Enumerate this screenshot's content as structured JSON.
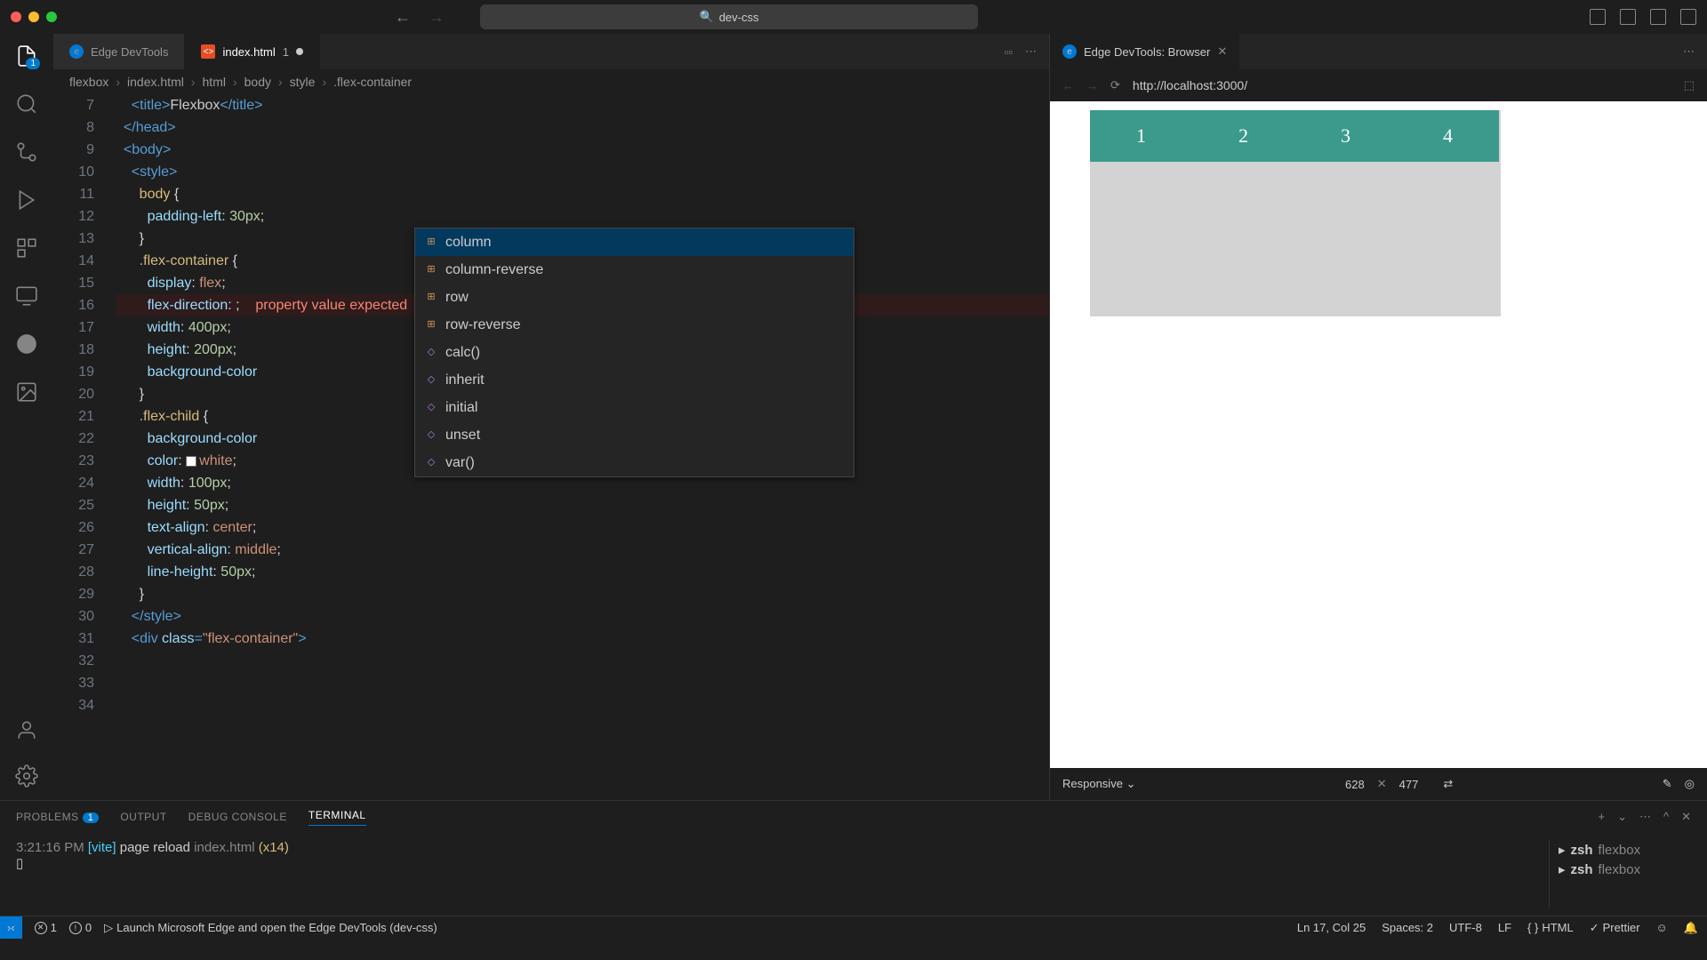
{
  "titlebar": {
    "project": "dev-css"
  },
  "tabs": [
    {
      "label": "Edge DevTools",
      "type": "edge"
    },
    {
      "label": "index.html",
      "type": "html",
      "count": "1",
      "dirty": true
    }
  ],
  "breadcrumb": [
    "flexbox",
    "index.html",
    "html",
    "body",
    "style",
    ".flex-container"
  ],
  "code": {
    "lines": [
      {
        "n": 7,
        "html": "    <span class='tag'>&lt;<span class='tag-name'>title</span>&gt;</span>Flexbox<span class='tag'>&lt;/<span class='tag-name'>title</span>&gt;</span>"
      },
      {
        "n": 8,
        "html": "  <span class='tag'>&lt;/<span class='tag-name'>head</span>&gt;</span>"
      },
      {
        "n": 9,
        "html": "  <span class='tag'>&lt;<span class='tag-name'>body</span>&gt;</span>"
      },
      {
        "n": 10,
        "html": "    <span class='tag'>&lt;<span class='tag-name'>style</span>&gt;</span>"
      },
      {
        "n": 11,
        "html": "      <span class='sel'>body</span> <span class='punct'>{</span>"
      },
      {
        "n": 12,
        "html": "        <span class='prop'>padding-left</span><span class='punct'>:</span> <span class='num'>30px</span><span class='punct'>;</span>"
      },
      {
        "n": 13,
        "html": "      <span class='punct'>}</span>"
      },
      {
        "n": 14,
        "html": ""
      },
      {
        "n": 15,
        "html": "      <span class='sel'>.flex-container</span> <span class='punct'>{</span>"
      },
      {
        "n": 16,
        "html": "        <span class='prop'>display</span><span class='punct'>:</span> <span class='val'>flex</span><span class='punct'>;</span>"
      },
      {
        "n": 17,
        "error": true,
        "html": "        <span class='prop'>flex-direction</span><span class='punct'>:</span> <span class='punct'>;</span>    <span class='error-msg'>property value expected</span>"
      },
      {
        "n": 18,
        "html": "        <span class='prop'>width</span><span class='punct'>:</span> <span class='num'>400px</span><span class='punct'>;</span>"
      },
      {
        "n": 19,
        "html": "        <span class='prop'>height</span><span class='punct'>:</span> <span class='num'>200px</span><span class='punct'>;</span>"
      },
      {
        "n": 20,
        "html": "        <span class='prop'>background-color</span>"
      },
      {
        "n": 21,
        "html": "      <span class='punct'>}</span>"
      },
      {
        "n": 22,
        "html": ""
      },
      {
        "n": 23,
        "html": "      <span class='sel'>.flex-child</span> <span class='punct'>{</span>"
      },
      {
        "n": 24,
        "html": "        <span class='prop'>background-color</span>"
      },
      {
        "n": 25,
        "html": "        <span class='prop'>color</span><span class='punct'>:</span> <span class='color-swatch'></span><span class='val'>white</span><span class='punct'>;</span>"
      },
      {
        "n": 26,
        "html": "        <span class='prop'>width</span><span class='punct'>:</span> <span class='num'>100px</span><span class='punct'>;</span>"
      },
      {
        "n": 27,
        "html": "        <span class='prop'>height</span><span class='punct'>:</span> <span class='num'>50px</span><span class='punct'>;</span>"
      },
      {
        "n": 28,
        "html": "        <span class='prop'>text-align</span><span class='punct'>:</span> <span class='val'>center</span><span class='punct'>;</span>"
      },
      {
        "n": 29,
        "html": "        <span class='prop'>vertical-align</span><span class='punct'>:</span> <span class='val'>middle</span><span class='punct'>;</span>"
      },
      {
        "n": 30,
        "html": "        <span class='prop'>line-height</span><span class='punct'>:</span> <span class='num'>50px</span><span class='punct'>;</span>"
      },
      {
        "n": 31,
        "html": "      <span class='punct'>}</span>"
      },
      {
        "n": 32,
        "html": "    <span class='tag'>&lt;/<span class='tag-name'>style</span>&gt;</span>"
      },
      {
        "n": 33,
        "html": ""
      },
      {
        "n": 34,
        "html": "    <span class='tag'>&lt;<span class='tag-name'>div</span> <span class='attr'>class</span>=<span class='str'>\"flex-container\"</span>&gt;</span>"
      }
    ]
  },
  "autocomplete": [
    {
      "label": "column",
      "kind": "value",
      "selected": true
    },
    {
      "label": "column-reverse",
      "kind": "value"
    },
    {
      "label": "row",
      "kind": "value"
    },
    {
      "label": "row-reverse",
      "kind": "value"
    },
    {
      "label": "calc()",
      "kind": "func"
    },
    {
      "label": "inherit",
      "kind": "func"
    },
    {
      "label": "initial",
      "kind": "func"
    },
    {
      "label": "unset",
      "kind": "func"
    },
    {
      "label": "var()",
      "kind": "func"
    }
  ],
  "browser": {
    "tab_label": "Edge DevTools: Browser",
    "url": "http://localhost:3000/",
    "device": "Responsive",
    "width": "628",
    "height": "477",
    "flex_children": [
      "1",
      "2",
      "3",
      "4"
    ]
  },
  "panel": {
    "tabs": [
      "PROBLEMS",
      "OUTPUT",
      "DEBUG CONSOLE",
      "TERMINAL"
    ],
    "active_tab": "TERMINAL",
    "problems_count": "1",
    "terminal": {
      "time": "3:21:16 PM",
      "tag": "[vite]",
      "msg": "page reload",
      "file": "index.html",
      "count": "(x14)"
    },
    "shells": [
      {
        "name": "zsh",
        "cwd": "flexbox"
      },
      {
        "name": "zsh",
        "cwd": "flexbox"
      }
    ]
  },
  "statusbar": {
    "errors": "1",
    "warnings": "0",
    "launch_msg": "Launch Microsoft Edge and open the Edge DevTools (dev-css)",
    "cursor": "Ln 17, Col 25",
    "spaces": "Spaces: 2",
    "encoding": "UTF-8",
    "eol": "LF",
    "lang": "HTML",
    "prettier": "Prettier"
  }
}
